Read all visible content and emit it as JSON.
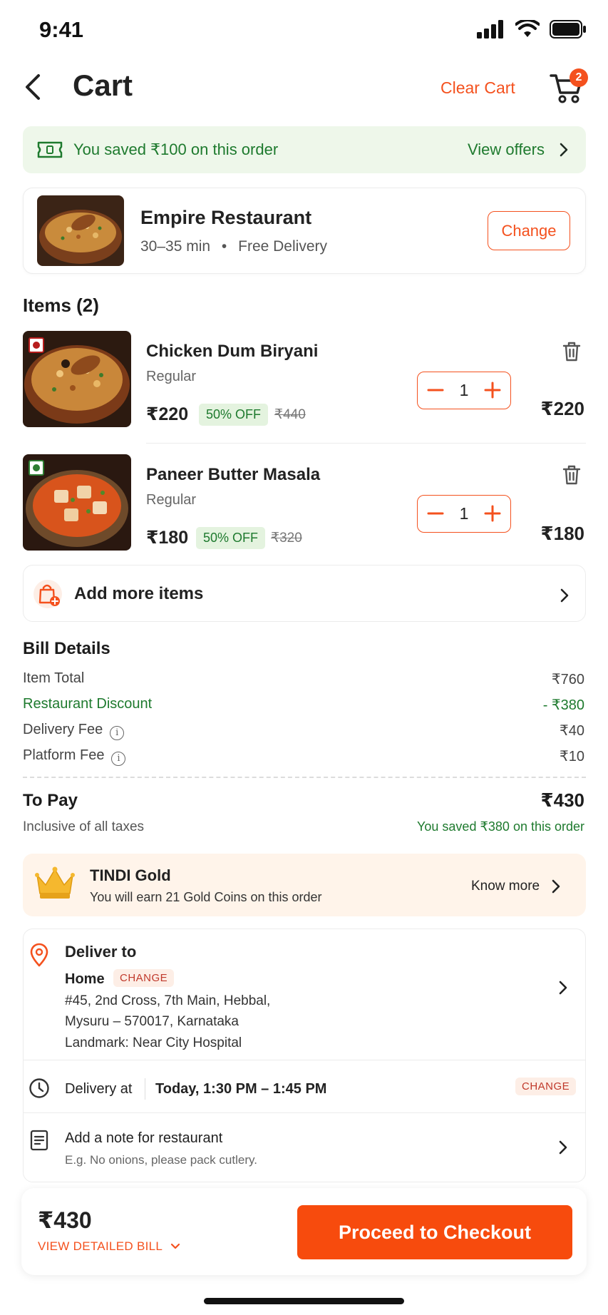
{
  "status_bar": {
    "time": "9:41"
  },
  "header": {
    "title": "Cart",
    "clear_cart": "Clear Cart",
    "cart_count": "2"
  },
  "savings_banner": {
    "text": "You saved ₹100 on this order",
    "link": "View offers"
  },
  "restaurant": {
    "name": "Empire Restaurant",
    "eta": "30–35 min",
    "separator": "•",
    "delivery": "Free Delivery",
    "change_label": "Change"
  },
  "items_section": {
    "title": "Items (2)",
    "items": [
      {
        "name": "Chicken Dum Biryani",
        "variant": "Regular",
        "price": "₹220",
        "discount": "50% OFF",
        "original_price": "₹440",
        "quantity": "1",
        "total": "₹220",
        "veg": false
      },
      {
        "name": "Paneer Butter Masala",
        "variant": "Regular",
        "price": "₹180",
        "discount": "50% OFF",
        "original_price": "₹320",
        "quantity": "1",
        "total": "₹180",
        "veg": true
      }
    ]
  },
  "add_more": {
    "label": "Add more items"
  },
  "bill": {
    "title": "Bill Details",
    "rows": [
      {
        "label": "Item Total",
        "value": "₹760"
      },
      {
        "label": "Restaurant Discount",
        "value": "- ₹380"
      },
      {
        "label": "Delivery Fee",
        "value": "₹40"
      },
      {
        "label": "Platform Fee",
        "value": "₹10"
      }
    ],
    "to_pay_label": "To Pay",
    "to_pay_value": "₹430",
    "taxes_note": "Inclusive of all taxes",
    "saved_note": "You saved ₹380 on this order"
  },
  "gold": {
    "title": "TINDI Gold",
    "subtitle": "You will earn 21 Gold Coins on this order",
    "link": "Know more"
  },
  "delivery": {
    "title": "Deliver to",
    "address_label": "Home",
    "change_chip": "CHANGE",
    "address_line1": "#45, 2nd Cross, 7th Main, Hebbal,",
    "address_line2": "Mysuru – 570017, Karnataka",
    "landmark": "Landmark: Near City Hospital",
    "time_label": "Delivery at",
    "time_value": "Today, 1:30 PM – 1:45 PM",
    "time_change": "CHANGE",
    "note_title": "Add a note for restaurant",
    "note_placeholder": "E.g. No onions, please pack cutlery."
  },
  "bottom": {
    "total": "₹430",
    "detailed_bill": "VIEW DETAILED BILL",
    "checkout": "Proceed to Checkout"
  },
  "colors": {
    "accent": "#f4511e",
    "success": "#1e7a2e",
    "savings_bg": "#eef7ea",
    "gold_bg": "#fff4ea"
  }
}
